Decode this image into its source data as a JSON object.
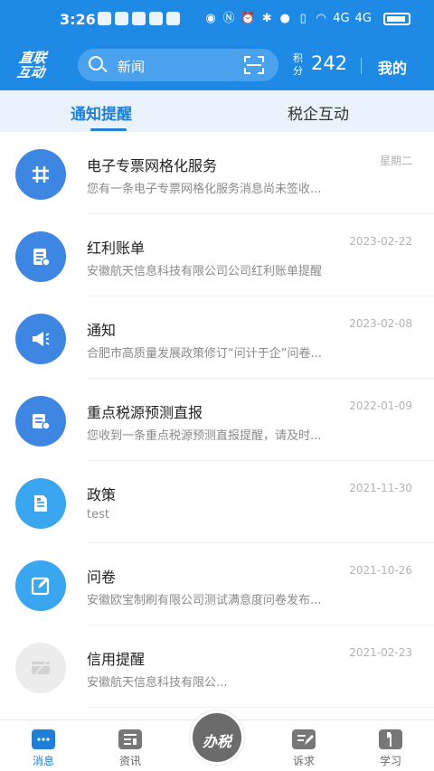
{
  "status": {
    "time": "3:26",
    "network": "4G"
  },
  "header": {
    "logo_line1": "直联",
    "logo_line2": "互动",
    "search_placeholder": "新闻",
    "points_label": "积分",
    "points_value": "242",
    "mine_label": "我的"
  },
  "tabs": [
    {
      "label": "通知提醒",
      "active": true
    },
    {
      "label": "税企互动",
      "active": false
    }
  ],
  "messages": [
    {
      "icon": "grid-icon",
      "color": "#3d87e3",
      "title": "电子专票网格化服务",
      "date": "星期二",
      "preview": "您有一条电子专票网格化服务消息尚未签收..."
    },
    {
      "icon": "bill-icon",
      "color": "#3d87e3",
      "title": "红利账单",
      "date": "2023-02-22",
      "preview": "安徽航天信息科技有限公司公司红利账单提醒"
    },
    {
      "icon": "megaphone-icon",
      "color": "#3d87e3",
      "title": "通知",
      "date": "2023-02-08",
      "preview": "合肥市高质量发展政策修订“问计于企”问卷..."
    },
    {
      "icon": "tax-report-icon",
      "color": "#3d87e3",
      "title": "重点税源预测直报",
      "date": "2022-01-09",
      "preview": "您收到一条重点税源预测直报提醒，请及时..."
    },
    {
      "icon": "policy-doc-icon",
      "color": "#3aa6ef",
      "title": "政策",
      "date": "2021-11-30",
      "preview": "test"
    },
    {
      "icon": "survey-edit-icon",
      "color": "#3aa6ef",
      "title": "问卷",
      "date": "2021-10-26",
      "preview": "安徽欧宝制刷有限公司测试满意度问卷发布..."
    },
    {
      "icon": "credit-card-icon",
      "color": "#ececec",
      "title": "信用提醒",
      "date": "2021-02-23",
      "preview": "安徽航天信息科技有限公..."
    }
  ],
  "bottom_nav": {
    "messages": "消息",
    "news": "资讯",
    "tax": "办税",
    "appeal": "诉求",
    "learn": "学习"
  },
  "colors": {
    "brand": "#1f8ae6",
    "active": "#1f7fd8"
  }
}
